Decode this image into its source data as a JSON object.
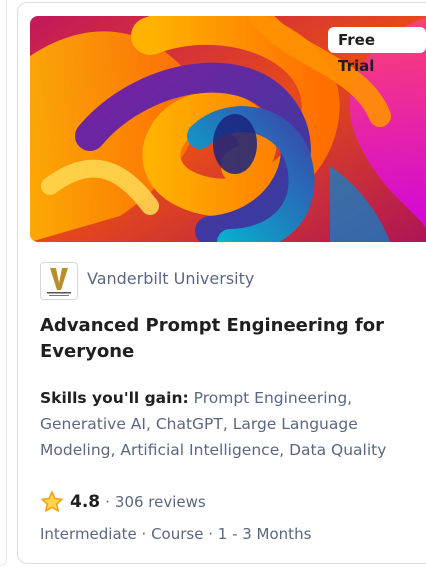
{
  "card": {
    "badge": "Free Trial",
    "partner": "Vanderbilt University",
    "logo_letter": "V",
    "logo_text": "VANDERBILT UNIVERSITY",
    "title": "Advanced Prompt Engineering for Everyone",
    "skills_label": "Skills you'll gain:",
    "skills": " Prompt Engineering, Generative AI, ChatGPT, Large Language Modeling, Artificial Intelligence, Data Quality",
    "rating": "4.8",
    "rating_sep": "·",
    "reviews": "306 reviews",
    "meta": "Intermediate · Course · 1 - 3 Months",
    "star_icon": "star-icon",
    "colors": {
      "star": "#f2a30f",
      "logo_gold": "#b8902b",
      "muted_text": "#5b6780",
      "title_text": "#1f1f1f"
    }
  }
}
